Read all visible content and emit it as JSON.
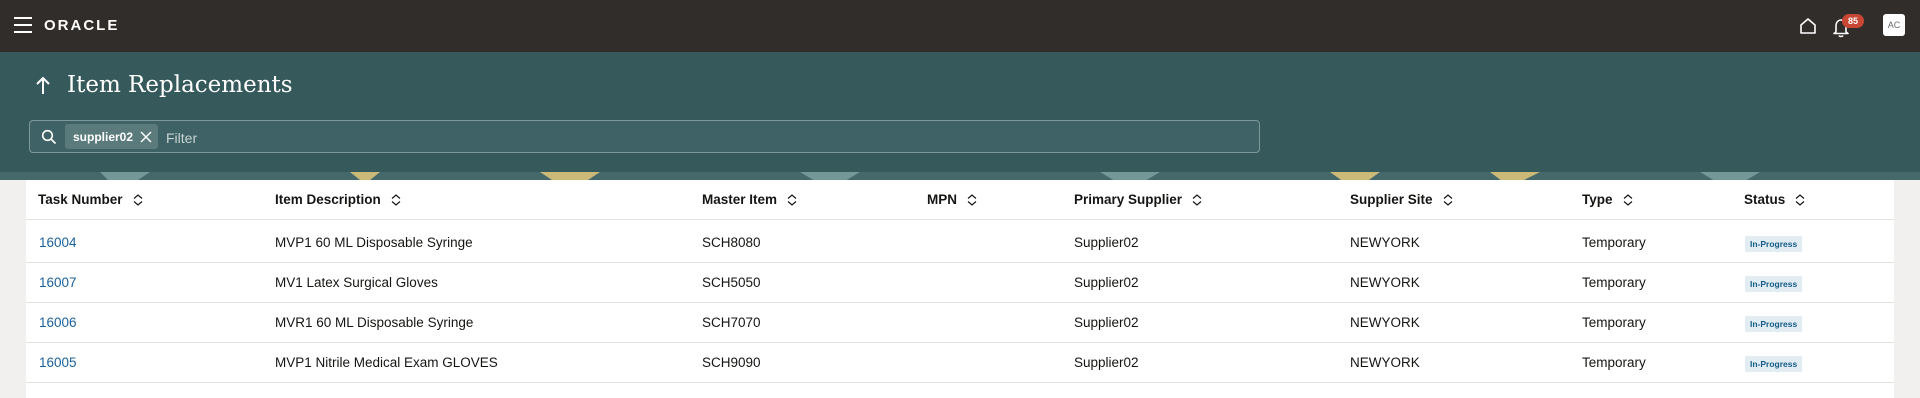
{
  "topbar": {
    "logo": "ORACLE",
    "notification_count": "85",
    "avatar_initials": "AC"
  },
  "header": {
    "title": "Item Replacements"
  },
  "filter": {
    "chip_label": "supplier02",
    "placeholder": "Filter"
  },
  "table": {
    "columns": [
      "Task Number",
      "Item Description",
      "Master Item",
      "MPN",
      "Primary Supplier",
      "Supplier Site",
      "Type",
      "Status"
    ],
    "rows": [
      {
        "task": "16004",
        "desc": "MVP1 60 ML Disposable Syringe",
        "master": "SCH8080",
        "mpn": "",
        "supplier": "Supplier02",
        "site": "NEWYORK",
        "type": "Temporary",
        "status": "In-Progress"
      },
      {
        "task": "16007",
        "desc": "MV1 Latex Surgical Gloves",
        "master": "SCH5050",
        "mpn": "",
        "supplier": "Supplier02",
        "site": "NEWYORK",
        "type": "Temporary",
        "status": "In-Progress"
      },
      {
        "task": "16006",
        "desc": "MVR1 60 ML Disposable Syringe",
        "master": "SCH7070",
        "mpn": "",
        "supplier": "Supplier02",
        "site": "NEWYORK",
        "type": "Temporary",
        "status": "In-Progress"
      },
      {
        "task": "16005",
        "desc": "MVP1 Nitrile Medical Exam GLOVES",
        "master": "SCH9090",
        "mpn": "",
        "supplier": "Supplier02",
        "site": "NEWYORK",
        "type": "Temporary",
        "status": "In-Progress"
      }
    ]
  },
  "colors": {
    "topbar_bg": "#312d2a",
    "band_bg": "#365a5c",
    "link": "#1c6199",
    "badge": "#c74634"
  }
}
